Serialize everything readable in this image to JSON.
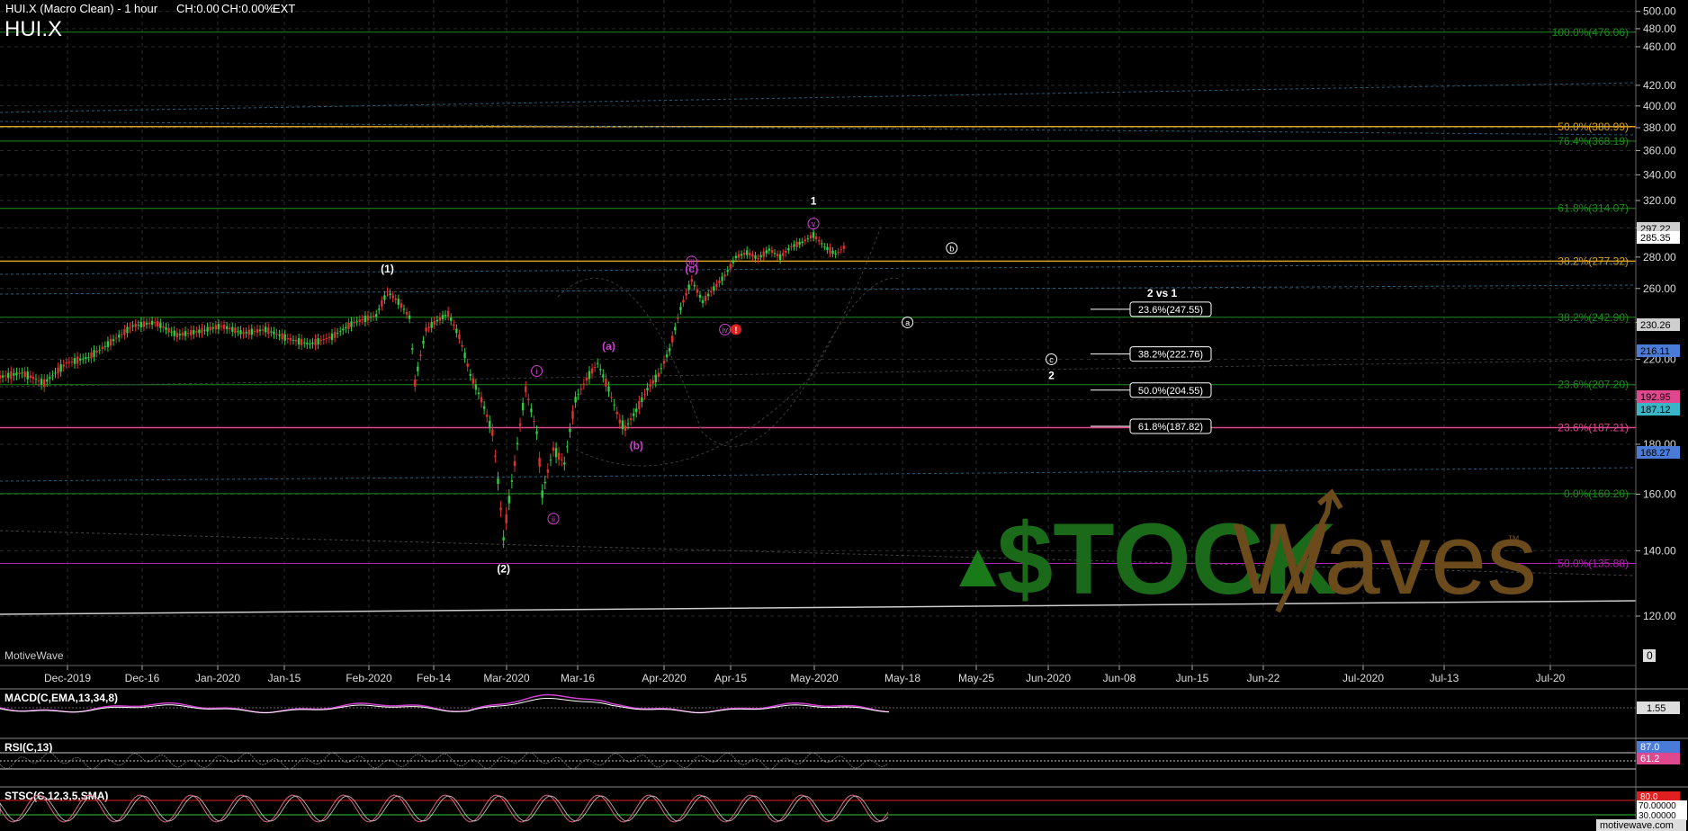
{
  "header": {
    "title_line": "HUI.X (Macro Clean) - 1 hour",
    "change_abs": "CH:0.00",
    "change_pct": "CH:0.00%",
    "session": "EXT",
    "symbol": "HUI.X"
  },
  "branding": {
    "platform": "MotiveWave",
    "footer_url": "motivewave.com",
    "watermark_left": "$TOCK",
    "watermark_right": "Waves",
    "watermark_tm": "™",
    "watermark_color_green": "#1a7a1a",
    "watermark_color_brown": "#6b4a1c"
  },
  "colors": {
    "background": "#000000",
    "grid": "#333333",
    "fib_green": "#1f8a1f",
    "fib_orange": "#d7a020",
    "fib_pink": "#e0488e",
    "fib_purple": "#b020b0",
    "wave_magenta": "#d040d0",
    "text_white": "#ffffff"
  },
  "chart_data": {
    "type": "line",
    "title": "HUI.X (Macro Clean) - 1 hour",
    "x_axis_labels": [
      "Dec-2019",
      "Dec-16",
      "Jan-2020",
      "Jan-15",
      "Feb-2020",
      "Feb-14",
      "Mar-2020",
      "Mar-16",
      "Apr-2020",
      "Apr-15",
      "May-2020",
      "May-18",
      "May-25",
      "Jun-2020",
      "Jun-08",
      "Jun-15",
      "Jun-22",
      "Jul-2020",
      "Jul-13",
      "Jul-20"
    ],
    "y_axis_ticks": [
      500,
      480,
      460,
      420,
      400,
      380,
      360,
      340,
      320,
      300,
      280,
      260,
      240,
      220,
      200,
      180,
      160,
      140,
      120
    ],
    "y_axis_zero_label": "0",
    "log_scale": true,
    "ylim": [
      110,
      505
    ],
    "grid": true,
    "series": [
      {
        "price_path": [
          [
            0,
            211
          ],
          [
            4,
            213
          ],
          [
            8,
            208
          ],
          [
            12,
            218
          ],
          [
            16,
            221
          ],
          [
            20,
            229
          ],
          [
            24,
            238
          ],
          [
            28,
            240
          ],
          [
            32,
            233
          ],
          [
            36,
            235
          ],
          [
            40,
            238
          ],
          [
            44,
            234
          ],
          [
            48,
            236
          ],
          [
            52,
            231
          ],
          [
            56,
            228
          ],
          [
            60,
            232
          ],
          [
            64,
            240
          ],
          [
            68,
            244
          ],
          [
            70,
            258
          ],
          [
            72,
            252
          ],
          [
            74,
            243
          ],
          [
            75,
            208
          ],
          [
            77,
            236
          ],
          [
            79,
            241
          ],
          [
            81,
            245
          ],
          [
            83,
            232
          ],
          [
            85,
            212
          ],
          [
            87,
            200
          ],
          [
            89,
            185
          ],
          [
            90,
            165
          ],
          [
            91,
            144
          ],
          [
            93,
            172
          ],
          [
            95,
            205
          ],
          [
            97,
            185
          ],
          [
            98,
            160
          ],
          [
            100,
            178
          ],
          [
            102,
            172
          ],
          [
            104,
            200
          ],
          [
            106,
            210
          ],
          [
            108,
            218
          ],
          [
            110,
            205
          ],
          [
            112,
            190
          ],
          [
            113,
            187
          ],
          [
            115,
            195
          ],
          [
            117,
            205
          ],
          [
            119,
            212
          ],
          [
            121,
            225
          ],
          [
            123,
            248
          ],
          [
            125,
            265
          ],
          [
            127,
            252
          ],
          [
            129,
            260
          ],
          [
            131,
            268
          ],
          [
            133,
            280
          ],
          [
            135,
            283
          ],
          [
            137,
            279
          ],
          [
            139,
            285
          ],
          [
            141,
            280
          ],
          [
            143,
            287
          ],
          [
            145,
            290
          ],
          [
            147,
            295
          ],
          [
            149,
            287
          ],
          [
            151,
            282
          ],
          [
            153,
            288
          ]
        ]
      }
    ],
    "value_badges": [
      {
        "value": "297.22",
        "color": "#cfcfcf"
      },
      {
        "value": "285.35",
        "color": "#ffffff"
      },
      {
        "value": "230.26",
        "color": "#cfcfcf"
      },
      {
        "value": "216.11",
        "color": "#4a7bd8"
      },
      {
        "value": "192.95",
        "color": "#e0488e"
      },
      {
        "value": "187.12",
        "color": "#3ab5c8"
      },
      {
        "value": "168.27",
        "color": "#4a7bd8"
      }
    ],
    "fib_lines": [
      {
        "label": "100.0%(476.06)",
        "value": 476.06,
        "color": "#1f8a1f"
      },
      {
        "label": "50.0%(380.99)",
        "value": 380.99,
        "color": "#d7a020"
      },
      {
        "label": "76.4%(368.19)",
        "value": 368.19,
        "color": "#1f8a1f"
      },
      {
        "label": "61.8%(314.07)",
        "value": 314.07,
        "color": "#1f8a1f"
      },
      {
        "label": "38.2%(277.32)",
        "value": 277.32,
        "color": "#d7a020"
      },
      {
        "label": "38.2%(242.90)",
        "value": 242.9,
        "color": "#1f8a1f"
      },
      {
        "label": "23.6%(207.20)",
        "value": 207.2,
        "color": "#1f8a1f"
      },
      {
        "label": "23.6%(187.21)",
        "value": 187.21,
        "color": "#e0488e"
      },
      {
        "label": "0.0%(160.20)",
        "value": 160.2,
        "color": "#1f8a1f"
      },
      {
        "label": "50.0%(135.88)",
        "value": 135.88,
        "color": "#b020b0"
      }
    ],
    "target_boxes": [
      {
        "label": "23.6%(247.55)",
        "value": 247.55
      },
      {
        "label": "38.2%(222.76)",
        "value": 222.76
      },
      {
        "label": "50.0%(204.55)",
        "value": 204.55
      },
      {
        "label": "61.8%(187.82)",
        "value": 187.82
      }
    ],
    "wave_labels": [
      {
        "text": "(1)",
        "style": "white",
        "date_idx": 70,
        "value": 270
      },
      {
        "text": "(2)",
        "style": "white",
        "date_idx": 91,
        "value": 133
      },
      {
        "text": "1",
        "style": "white",
        "date_idx": 147,
        "value": 317
      },
      {
        "text": "2 vs 1",
        "style": "white",
        "date_idx": 210,
        "value": 255
      },
      {
        "text": "2",
        "style": "white",
        "date_idx": 190,
        "value": 210
      },
      {
        "text": "i",
        "style": "circ-magenta",
        "date_idx": 97,
        "value": 214
      },
      {
        "text": "ii",
        "style": "circ-magenta",
        "date_idx": 100,
        "value": 151
      },
      {
        "text": "(a)",
        "style": "magenta",
        "date_idx": 110,
        "value": 225
      },
      {
        "text": "(b)",
        "style": "magenta",
        "date_idx": 115,
        "value": 178
      },
      {
        "text": "(c)",
        "style": "magenta",
        "date_idx": 125,
        "value": 270
      },
      {
        "text": "iii",
        "style": "circ-magenta",
        "date_idx": 125,
        "value": 277
      },
      {
        "text": "iv",
        "style": "circ-magenta",
        "date_idx": 131,
        "value": 236
      },
      {
        "text": "!",
        "style": "red-dot",
        "date_idx": 133,
        "value": 236
      },
      {
        "text": "v",
        "style": "circ-magenta",
        "date_idx": 147,
        "value": 303
      },
      {
        "text": "b",
        "style": "circ-white",
        "date_idx": 172,
        "value": 286
      },
      {
        "text": "a",
        "style": "circ-white",
        "date_idx": 164,
        "value": 240
      },
      {
        "text": "c",
        "style": "circ-white",
        "date_idx": 190,
        "value": 220
      }
    ],
    "indicators": [
      {
        "name": "MACD(C,EMA,13,34,8)",
        "value": "1.55"
      },
      {
        "name": "RSI(C,13)",
        "values": [
          "87.0",
          "61.2"
        ]
      },
      {
        "name": "STSC(C,12,3,5,SMA)",
        "values": [
          "80.0",
          "70.00000",
          "30.00000"
        ]
      }
    ]
  }
}
